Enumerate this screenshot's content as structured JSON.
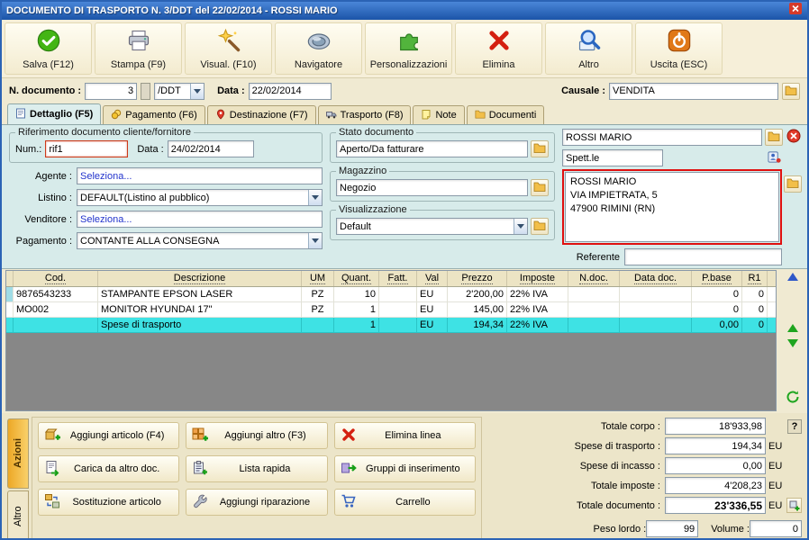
{
  "window": {
    "title": "DOCUMENTO DI TRASPORTO N. 3/DDT del 22/02/2014 - ROSSI MARIO"
  },
  "toolbar": {
    "buttons": [
      {
        "label": "Salva (F12)",
        "icon": "save-check-icon"
      },
      {
        "label": "Stampa (F9)",
        "icon": "printer-icon"
      },
      {
        "label": "Visual. (F10)",
        "icon": "magic-wand-icon"
      },
      {
        "label": "Navigatore",
        "icon": "compass-icon"
      },
      {
        "label": "Personalizzazioni",
        "icon": "puzzle-icon"
      },
      {
        "label": "Elimina",
        "icon": "red-x-icon"
      },
      {
        "label": "Altro",
        "icon": "magnifier-icon"
      },
      {
        "label": "Uscita (ESC)",
        "icon": "power-icon"
      }
    ]
  },
  "docnum": {
    "label": "N. documento :",
    "number": "3",
    "doc_type": "/DDT",
    "date_label": "Data :",
    "date": "22/02/2014",
    "causale_label": "Causale :",
    "causale": "VENDITA"
  },
  "tabs": [
    {
      "label": "Dettaglio (F5)"
    },
    {
      "label": "Pagamento (F6)"
    },
    {
      "label": "Destinazione (F7)"
    },
    {
      "label": "Trasporto (F8)"
    },
    {
      "label": "Note"
    },
    {
      "label": "Documenti"
    }
  ],
  "detail": {
    "riferimento": {
      "legend": "Riferimento documento cliente/fornitore",
      "num_label": "Num.:",
      "num_value": "rif1",
      "data_label": "Data :",
      "data_value": "24/02/2014"
    },
    "agente_label": "Agente :",
    "agente_value": "Seleziona...",
    "listino_label": "Listino :",
    "listino_value": "DEFAULT(Listino al pubblico)",
    "venditore_label": "Venditore :",
    "venditore_value": "Seleziona...",
    "pagamento_label": "Pagamento :",
    "pagamento_value": "CONTANTE ALLA CONSEGNA",
    "stato": {
      "legend": "Stato documento",
      "value": "Aperto/Da fatturare"
    },
    "magazzino": {
      "legend": "Magazzino",
      "value": "Negozio"
    },
    "visualizzazione": {
      "legend": "Visualizzazione",
      "value": "Default"
    },
    "cliente": {
      "name": "ROSSI MARIO",
      "salutation": "Spett.le",
      "address_lines": [
        "ROSSI MARIO",
        "VIA IMPIETRATA, 5",
        "47900 RIMINI (RN)"
      ],
      "referente_label": "Referente"
    }
  },
  "table": {
    "columns": [
      "Cod.",
      "Descrizione",
      "UM",
      "Quant.",
      "Fatt.",
      "Val",
      "Prezzo",
      "Imposte",
      "N.doc.",
      "Data doc.",
      "P.base",
      "R1"
    ],
    "rows": [
      {
        "cod": "9876543233",
        "descr": "STAMPANTE EPSON LASER",
        "um": "PZ",
        "quant": "10",
        "fatt": "",
        "val": "EU",
        "prezzo": "2'200,00",
        "imposte": "22% IVA",
        "ndoc": "",
        "datadoc": "",
        "pbase": "0",
        "r1": "0"
      },
      {
        "cod": "MO002",
        "descr": "MONITOR HYUNDAI 17\"",
        "um": "PZ",
        "quant": "1",
        "fatt": "",
        "val": "EU",
        "prezzo": "145,00",
        "imposte": "22% IVA",
        "ndoc": "",
        "datadoc": "",
        "pbase": "0",
        "r1": "0"
      },
      {
        "cod": "",
        "descr": "Spese di trasporto",
        "um": "",
        "quant": "1",
        "fatt": "",
        "val": "EU",
        "prezzo": "194,34",
        "imposte": "22% IVA",
        "ndoc": "",
        "datadoc": "",
        "pbase": "0,00",
        "r1": "0"
      }
    ]
  },
  "actions": {
    "tabs": [
      {
        "label": "Azioni"
      },
      {
        "label": "Altro"
      }
    ],
    "buttons": [
      "Aggiungi articolo (F4)",
      "Aggiungi altro (F3)",
      "Elimina linea",
      "Carica da altro doc.",
      "Lista rapida",
      "Gruppi di inserimento",
      "Sostituzione articolo",
      "Aggiungi riparazione",
      "Carrello"
    ]
  },
  "totals": {
    "rows": [
      {
        "label": "Totale corpo :",
        "value": "18'933,98",
        "suffix": ""
      },
      {
        "label": "Spese di trasporto :",
        "value": "194,34",
        "suffix": "EU"
      },
      {
        "label": "Spese di incasso :",
        "value": "0,00",
        "suffix": "EU"
      },
      {
        "label": "Totale imposte :",
        "value": "4'208,23",
        "suffix": "EU"
      },
      {
        "label": "Totale documento :",
        "value": "23'336,55",
        "suffix": "EU"
      }
    ],
    "help_label": "?",
    "peso_label": "Peso lordo :",
    "peso_value": "99",
    "volume_label": "Volume :",
    "volume_value": "0"
  },
  "colors": {
    "accent_blue": "#1b54a8",
    "selected_row": "#3ee2e4",
    "highlight_red": "#e01010",
    "panel_cyan": "#d7ebea",
    "cream": "#f0ead2"
  },
  "icons": {
    "save-check-icon": "green circle with white check",
    "printer-icon": "gray printer",
    "magic-wand-icon": "gold star wand",
    "compass-icon": "steel compass ellipse",
    "puzzle-icon": "green puzzle piece",
    "red-x-icon": "red X",
    "magnifier-icon": "blue magnifying glass",
    "power-icon": "orange power button",
    "folder-icon": "gold folder",
    "delete-icon": "red circle white x",
    "contact-icon": "address card person",
    "close-icon": "red window close x",
    "scroll-up-icon": "blue triangle up",
    "move-up-icon": "green triangle up",
    "move-down-icon": "green triangle down",
    "refresh-icon": "green circular arrow"
  }
}
